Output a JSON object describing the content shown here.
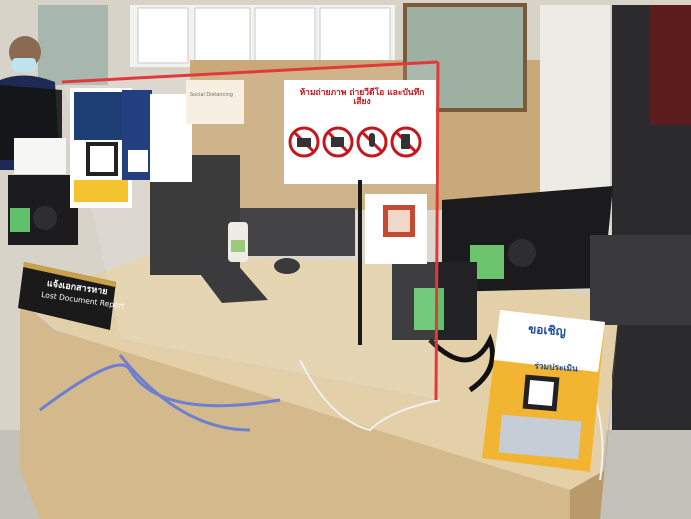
{
  "sign": {
    "title": "ห้ามถ่ายภาพ ถ่ายวีดีโอ และบันทึกเสียง",
    "icons": [
      "no-camera-icon",
      "no-video-icon",
      "no-microphone-icon",
      "no-phone-icon"
    ]
  },
  "nameplate": {
    "thai": "แจ้งเอกสารหาย",
    "english": "Lost Document Report"
  },
  "flyer": {
    "title": "ขอเชิญ",
    "subtitle": "ร่วมประเมิน"
  },
  "wall_notice": {
    "text": "Social Distancing"
  },
  "colors": {
    "sign_red": "#c4161c",
    "desk": "#e3cfa8",
    "nameplate": "#1a1a1a",
    "flyer_yellow": "#f2b531"
  }
}
